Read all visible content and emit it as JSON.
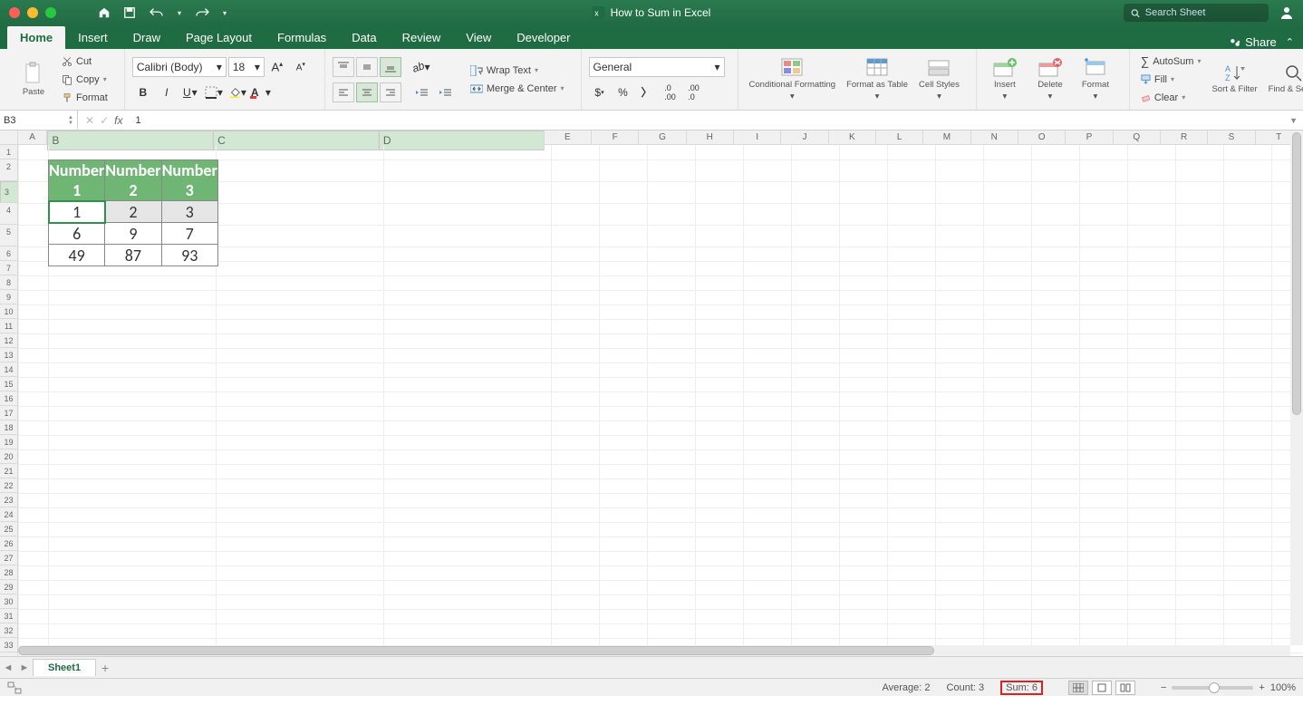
{
  "window": {
    "title": "How to Sum in Excel",
    "search_placeholder": "Search Sheet",
    "share": "Share"
  },
  "tabs": [
    "Home",
    "Insert",
    "Draw",
    "Page Layout",
    "Formulas",
    "Data",
    "Review",
    "View",
    "Developer"
  ],
  "clipboard": {
    "paste": "Paste",
    "cut": "Cut",
    "copy": "Copy",
    "format": "Format"
  },
  "font": {
    "name": "Calibri (Body)",
    "size": "18",
    "bold": "B",
    "italic": "I",
    "underline": "U"
  },
  "align": {
    "wrap": "Wrap Text",
    "merge": "Merge & Center"
  },
  "number": {
    "format": "General"
  },
  "table_group": {
    "cf": "Conditional Formatting",
    "fat": "Format as Table",
    "cs": "Cell Styles"
  },
  "cells": {
    "insert": "Insert",
    "delete": "Delete",
    "format": "Format"
  },
  "editing": {
    "autosum": "AutoSum",
    "fill": "Fill",
    "clear": "Clear",
    "sort": "Sort & Filter",
    "find": "Find & Select"
  },
  "namebox": "B3",
  "formula": "1",
  "columns": [
    "A",
    "B",
    "C",
    "D",
    "E",
    "F",
    "G",
    "H",
    "I",
    "J",
    "K",
    "L",
    "M",
    "N",
    "O",
    "P",
    "Q",
    "R",
    "S",
    "T"
  ],
  "col_widths": {
    "A": 33,
    "data": 185,
    "rest": 53
  },
  "headers": [
    "Number 1",
    "Number 2",
    "Number 3"
  ],
  "data": [
    [
      "1",
      "2",
      "3"
    ],
    [
      "6",
      "9",
      "7"
    ],
    [
      "49",
      "87",
      "93"
    ]
  ],
  "sheet_tab": "Sheet1",
  "status": {
    "avg": "Average: 2",
    "count": "Count: 3",
    "sum": "Sum: 6",
    "zoom": "100%"
  }
}
